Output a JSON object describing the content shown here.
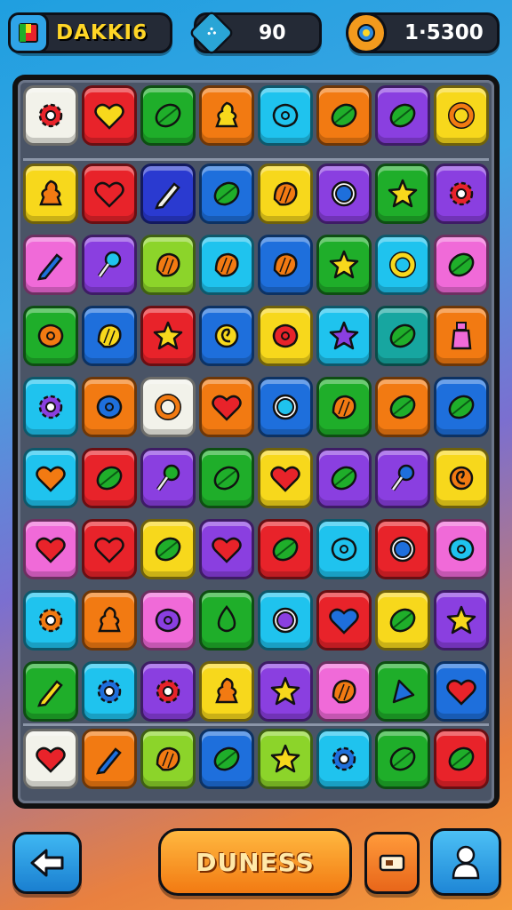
{
  "hud": {
    "level_label": "DAKKI6",
    "moves": "90",
    "score": "1·5300",
    "level_icon": "book-icon",
    "moves_icon": "gem-icon",
    "score_icon": "coin-gear-icon"
  },
  "buttons": {
    "back_icon": "left-arrow-icon",
    "main_label": "DUNESS",
    "shop_icon": "ticket-icon",
    "profile_icon": "person-icon"
  },
  "colors": {
    "red": "#e8232a",
    "green": "#1fae2a",
    "orange": "#f27a12",
    "cyan": "#1fc3ee",
    "blue": "#1e6fdc",
    "purple": "#8a3fe0",
    "yellow": "#f7d81c",
    "pink": "#f06ad8",
    "lime": "#8cd42a",
    "teal": "#17a6a0",
    "white": "#f2f2ea",
    "navy": "#2a3ad0"
  },
  "board": [
    [
      [
        "white",
        "red",
        "gear"
      ],
      [
        "red",
        "yellow",
        "heart"
      ],
      [
        "green",
        "green",
        "leaf"
      ],
      [
        "orange",
        "yellow",
        "cream"
      ],
      [
        "cyan",
        "cyan",
        "blob"
      ],
      [
        "orange",
        "green",
        "leaf"
      ],
      [
        "purple",
        "green",
        "leaf"
      ],
      [
        "yellow",
        "orange",
        "ring"
      ]
    ],
    [
      [
        "yellow",
        "orange",
        "cream"
      ],
      [
        "red",
        "red",
        "heart"
      ],
      [
        "navy",
        "white",
        "pen"
      ],
      [
        "blue",
        "green",
        "leaf"
      ],
      [
        "yellow",
        "orange",
        "shell"
      ],
      [
        "purple",
        "blue",
        "orb"
      ],
      [
        "green",
        "yellow",
        "star"
      ],
      [
        "purple",
        "red",
        "gear"
      ]
    ],
    [
      [
        "pink",
        "blue",
        "pen"
      ],
      [
        "purple",
        "cyan",
        "pin"
      ],
      [
        "lime",
        "orange",
        "shell"
      ],
      [
        "cyan",
        "orange",
        "shell"
      ],
      [
        "blue",
        "orange",
        "shell"
      ],
      [
        "green",
        "yellow",
        "star"
      ],
      [
        "cyan",
        "yellow",
        "ring"
      ],
      [
        "pink",
        "green",
        "leaf"
      ]
    ],
    [
      [
        "green",
        "orange",
        "blob"
      ],
      [
        "blue",
        "yellow",
        "shell"
      ],
      [
        "red",
        "yellow",
        "star"
      ],
      [
        "blue",
        "yellow",
        "swirl"
      ],
      [
        "yellow",
        "red",
        "blob"
      ],
      [
        "cyan",
        "purple",
        "star"
      ],
      [
        "teal",
        "green",
        "leaf"
      ],
      [
        "orange",
        "pink",
        "bottle"
      ]
    ],
    [
      [
        "cyan",
        "purple",
        "gear"
      ],
      [
        "orange",
        "blue",
        "blob"
      ],
      [
        "white",
        "orange",
        "ring"
      ],
      [
        "orange",
        "red",
        "heart"
      ],
      [
        "blue",
        "cyan",
        "orb"
      ],
      [
        "green",
        "orange",
        "shell"
      ],
      [
        "orange",
        "green",
        "leaf"
      ],
      [
        "blue",
        "green",
        "leaf"
      ]
    ],
    [
      [
        "cyan",
        "orange",
        "heart"
      ],
      [
        "red",
        "green",
        "leaf"
      ],
      [
        "purple",
        "green",
        "pin"
      ],
      [
        "green",
        "green",
        "leaf"
      ],
      [
        "yellow",
        "red",
        "heart"
      ],
      [
        "purple",
        "green",
        "leaf"
      ],
      [
        "purple",
        "blue",
        "pin"
      ],
      [
        "yellow",
        "orange",
        "swirl"
      ]
    ],
    [
      [
        "pink",
        "red",
        "heart"
      ],
      [
        "red",
        "red",
        "heart"
      ],
      [
        "yellow",
        "green",
        "leaf"
      ],
      [
        "purple",
        "red",
        "heart"
      ],
      [
        "red",
        "green",
        "leaf"
      ],
      [
        "cyan",
        "cyan",
        "blob"
      ],
      [
        "red",
        "blue",
        "orb"
      ],
      [
        "pink",
        "cyan",
        "blob"
      ]
    ],
    [
      [
        "cyan",
        "orange",
        "gear"
      ],
      [
        "orange",
        "orange",
        "cream"
      ],
      [
        "pink",
        "purple",
        "blob"
      ],
      [
        "green",
        "green",
        "drop"
      ],
      [
        "cyan",
        "purple",
        "orb"
      ],
      [
        "red",
        "blue",
        "heart"
      ],
      [
        "yellow",
        "green",
        "leaf"
      ],
      [
        "purple",
        "yellow",
        "star"
      ]
    ],
    [
      [
        "green",
        "yellow",
        "pen"
      ],
      [
        "cyan",
        "blue",
        "gear"
      ],
      [
        "purple",
        "red",
        "gear"
      ],
      [
        "yellow",
        "orange",
        "cream"
      ],
      [
        "purple",
        "yellow",
        "star"
      ],
      [
        "pink",
        "orange",
        "shell"
      ],
      [
        "green",
        "blue",
        "triangle"
      ],
      [
        "blue",
        "red",
        "heart"
      ]
    ],
    [
      [
        "white",
        "red",
        "heart"
      ],
      [
        "orange",
        "blue",
        "pen"
      ],
      [
        "lime",
        "orange",
        "shell"
      ],
      [
        "blue",
        "green",
        "leaf"
      ],
      [
        "lime",
        "yellow",
        "star"
      ],
      [
        "cyan",
        "blue",
        "gear"
      ],
      [
        "green",
        "green",
        "leaf"
      ],
      [
        "red",
        "green",
        "leaf"
      ]
    ]
  ]
}
